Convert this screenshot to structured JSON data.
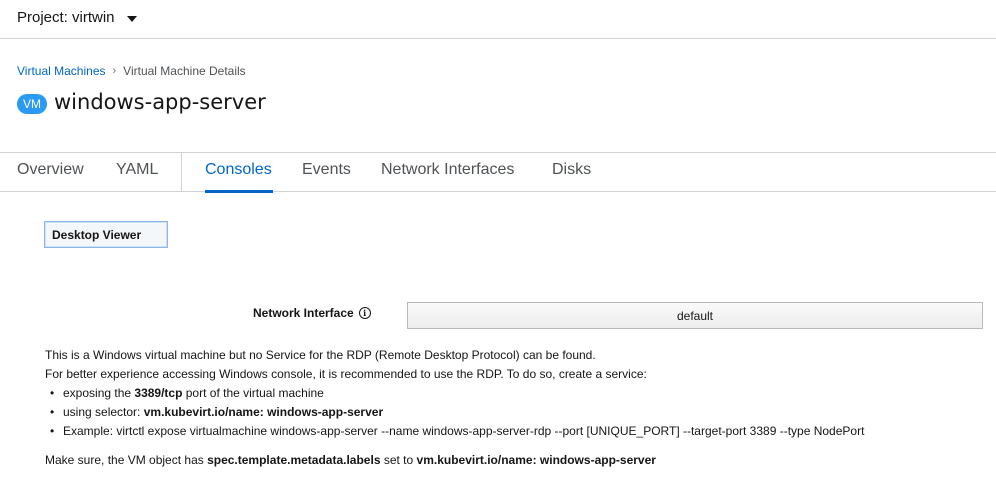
{
  "project": {
    "label": "Project: virtwin"
  },
  "breadcrumb": {
    "parent": "Virtual Machines",
    "separator": "›",
    "current": "Virtual Machine Details"
  },
  "header": {
    "badge": "VM",
    "name": "windows-app-server"
  },
  "tabs": [
    {
      "label": "Overview",
      "active": false
    },
    {
      "label": "YAML",
      "active": false
    },
    {
      "label": "Consoles",
      "active": true
    },
    {
      "label": "Events",
      "active": false
    },
    {
      "label": "Network Interfaces",
      "active": false
    },
    {
      "label": "Disks",
      "active": false
    }
  ],
  "console": {
    "viewer_button": "Desktop Viewer",
    "network_interface_label": "Network Interface",
    "network_interface_value": "default"
  },
  "message": {
    "line1": "This is a Windows virtual machine but no Service for the RDP (Remote Desktop Protocol) can be found.",
    "line2": "For better experience accessing Windows console, it is recommended to use the RDP. To do so, create a service:",
    "bullet1_pre": "exposing the ",
    "bullet1_bold": "3389/tcp",
    "bullet1_post": " port of the virtual machine",
    "bullet2_pre": "using selector: ",
    "bullet2_bold": "vm.kubevirt.io/name: windows-app-server",
    "bullet3": "Example: virtctl expose virtualmachine windows-app-server --name windows-app-server-rdp --port [UNIQUE_PORT] --target-port 3389 --type NodePort",
    "last_pre": "Make sure, the VM object has ",
    "last_bold1": "spec.template.metadata.labels",
    "last_mid": " set to ",
    "last_bold2": "vm.kubevirt.io/name: windows-app-server"
  },
  "colors": {
    "link": "#0066cc",
    "badge": "#2b9af3",
    "active_tab": "#0066cc"
  },
  "icons": {
    "project_dropdown": "caret-down-icon",
    "network_info": "info-circle-icon"
  }
}
